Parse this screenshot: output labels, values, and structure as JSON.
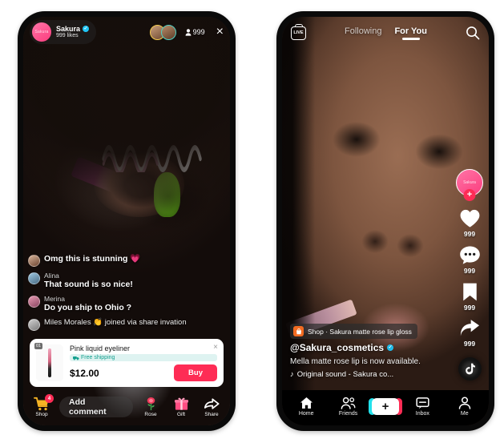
{
  "live_phone": {
    "header": {
      "host_avatar_label": "Sakura",
      "host_name": "Sakura",
      "verified_mark": "✓",
      "likes": "999 likes",
      "viewer_count": "999",
      "viewer_icon": "person-icon",
      "close_icon": "×"
    },
    "comments": [
      {
        "user": "",
        "text": "Omg this is stunning 💗",
        "avatar": "a1"
      },
      {
        "user": "Alina",
        "text": "That sound is so nice!",
        "avatar": "a2"
      },
      {
        "user": "Merina",
        "text": "Do you ship to Ohio ?",
        "avatar": "a3"
      },
      {
        "user": "",
        "text": "Miles Morales 👏 joined via share invation",
        "avatar": "a4",
        "join": true
      }
    ],
    "product": {
      "index_badge": "01",
      "title": "Pink liquid eyeliner",
      "shipping_badge": "Free shipping",
      "shipping_icon": "truck-icon",
      "price": "$12.00",
      "buy_label": "Buy",
      "close_icon": "×"
    },
    "bottom_bar": {
      "shop_label": "Shop",
      "shop_badge": "4",
      "comment_placeholder": "Add comment",
      "rose_label": "Rose",
      "gift_label": "Gift",
      "share_label": "Share"
    }
  },
  "fyp_phone": {
    "top": {
      "live_label": "LIVE",
      "tabs": [
        {
          "label": "Following",
          "active": false
        },
        {
          "label": "For You",
          "active": true
        }
      ],
      "search_icon": "search-icon"
    },
    "rail": {
      "avatar_label": "Sakura",
      "follow_plus": "+",
      "like_count": "999",
      "comment_count": "999",
      "bookmark_count": "999",
      "share_count": "999",
      "disc_icon": "tiktok-note-icon"
    },
    "caption": {
      "shop_text": "Shop · Sakura matte rose lip gloss",
      "shop_icon": "shopping-bag-icon",
      "username": "@Sakura_cosmetics",
      "verified_mark": "✓",
      "description": "Mella matte rose lip is now available.",
      "sound_icon": "♪",
      "sound_text": "Original sound - Sakura co..."
    },
    "nav": [
      {
        "label": "Home",
        "icon": "home-icon"
      },
      {
        "label": "Friends",
        "icon": "friends-icon"
      },
      {
        "label": "",
        "icon": "plus-create-icon"
      },
      {
        "label": "Inbox",
        "icon": "inbox-icon"
      },
      {
        "label": "Me",
        "icon": "profile-icon"
      }
    ]
  },
  "colors": {
    "accent_pink": "#FE2C55",
    "accent_cyan": "#22E1EC",
    "verified_blue": "#20C6F7",
    "shipping_teal": "#14A08F",
    "shop_orange": "#F26B21",
    "page_background": "#FFFFFF"
  }
}
